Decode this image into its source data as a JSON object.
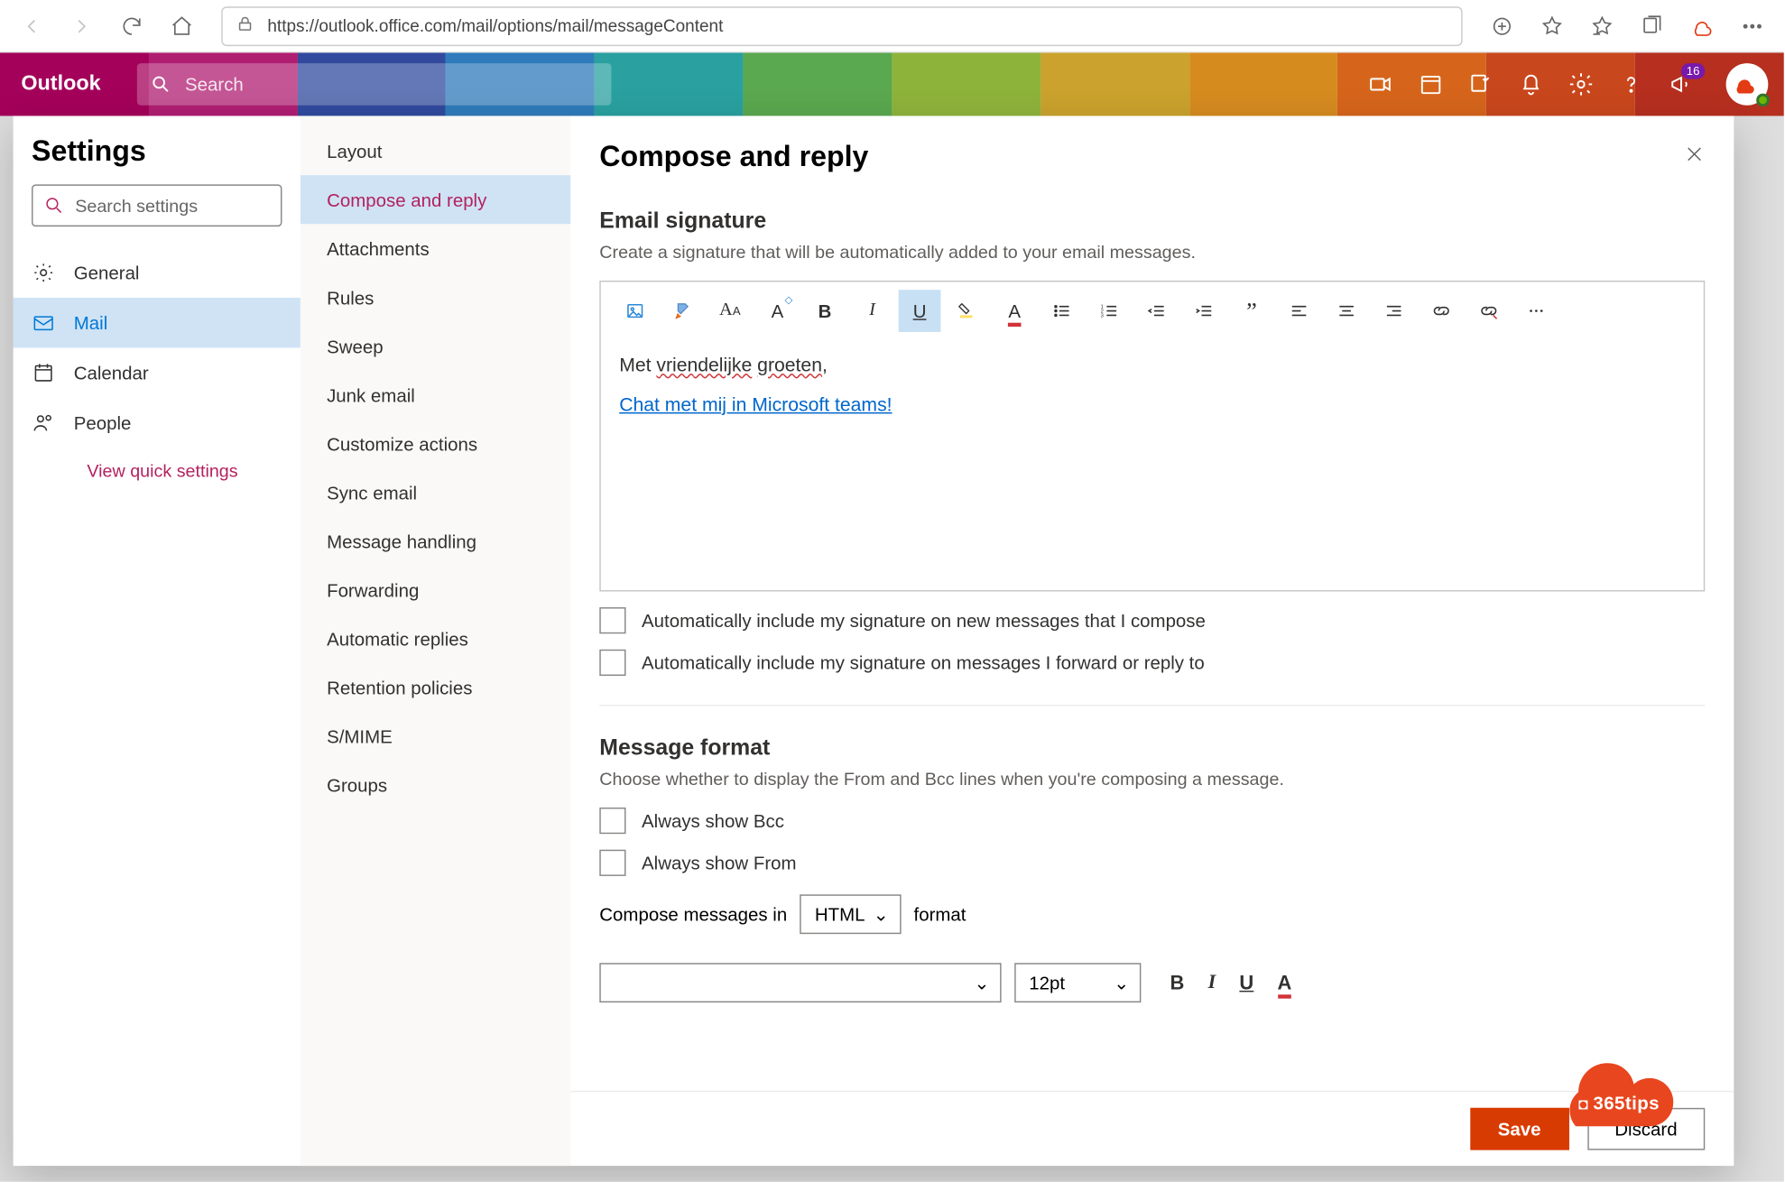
{
  "browser": {
    "url": "https://outlook.office.com/mail/options/mail/messageContent"
  },
  "header": {
    "brand": "Outlook",
    "search_placeholder": "Search",
    "notif_badge": "16"
  },
  "settings": {
    "title": "Settings",
    "search_placeholder": "Search settings",
    "items": {
      "general": "General",
      "mail": "Mail",
      "calendar": "Calendar",
      "people": "People"
    },
    "quick": "View quick settings"
  },
  "subnav": {
    "items": [
      "Layout",
      "Compose and reply",
      "Attachments",
      "Rules",
      "Sweep",
      "Junk email",
      "Customize actions",
      "Sync email",
      "Message handling",
      "Forwarding",
      "Automatic replies",
      "Retention policies",
      "S/MIME",
      "Groups"
    ]
  },
  "main": {
    "title": "Compose and reply",
    "sig_section": "Email signature",
    "sig_helper": "Create a signature that will be automatically added to your email messages.",
    "sig_line1_pre": "Met ",
    "sig_line1_w1": "vriendelijke",
    "sig_line1_w2": "groeten",
    "sig_line1_post": ",",
    "sig_link": "Chat met mij in Microsoft teams!",
    "chk_new": "Automatically include my signature on new messages that I compose",
    "chk_reply": "Automatically include my signature on messages I forward or reply to",
    "fmt_section": "Message format",
    "fmt_helper": "Choose whether to display the From and Bcc lines when you're composing a message.",
    "chk_bcc": "Always show Bcc",
    "chk_from": "Always show From",
    "compose_in_pre": "Compose messages in",
    "compose_in_value": "HTML",
    "compose_in_post": "format",
    "font_size": "12pt",
    "save": "Save",
    "discard": "Discard"
  },
  "watermark": "365tips"
}
